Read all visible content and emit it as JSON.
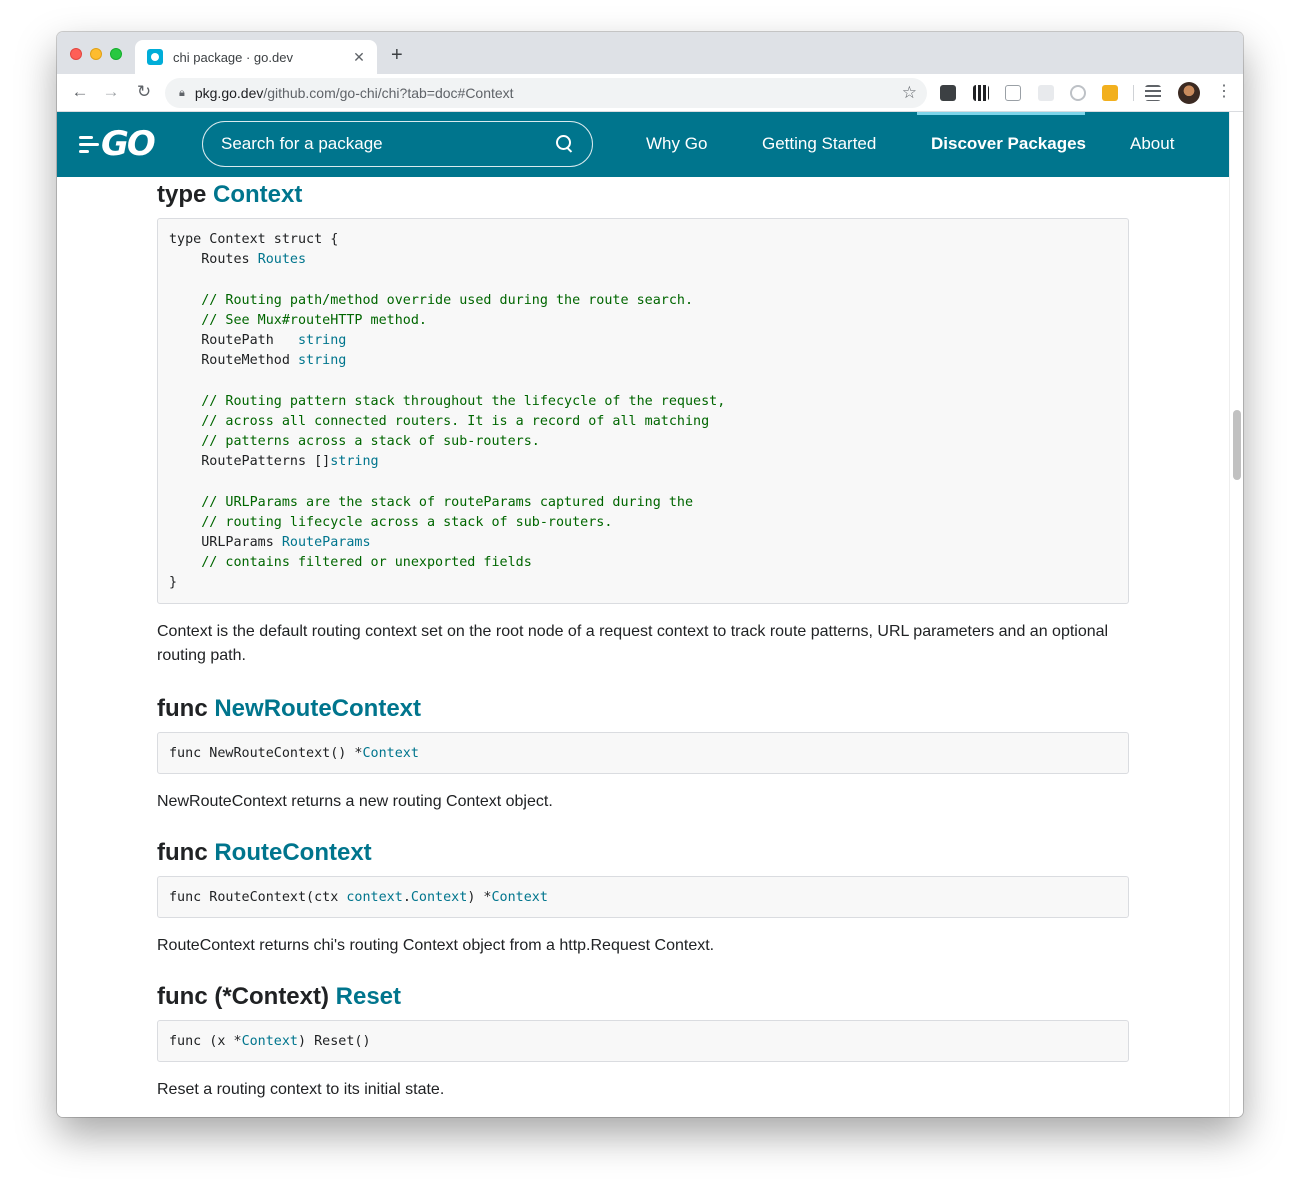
{
  "browser": {
    "tab_title": "chi package · go.dev",
    "tab_close": "✕",
    "new_tab": "+",
    "url_host": "pkg.go.dev",
    "url_path": "/github.com/go-chi/chi?tab=doc#Context"
  },
  "site": {
    "logo": "GO",
    "search_placeholder": "Search for a package",
    "nav": {
      "why_go": "Why Go",
      "getting_started": "Getting Started",
      "discover_packages": "Discover Packages",
      "about": "About"
    },
    "brand_color": "#00758d"
  },
  "doc": {
    "context": {
      "prefix": "type",
      "name": "Context",
      "code": {
        "l1": "type Context struct {",
        "routes_field": "    Routes ",
        "routes_type": "Routes",
        "comment1a": "    // Routing path/method override used during the route search.",
        "comment1b": "    // See Mux#routeHTTP method.",
        "routepath_field": "    RoutePath   ",
        "routepath_type": "string",
        "routemethod_field": "    RouteMethod ",
        "routemethod_type": "string",
        "comment2a": "    // Routing pattern stack throughout the lifecycle of the request,",
        "comment2b": "    // across all connected routers. It is a record of all matching",
        "comment2c": "    // patterns across a stack of sub-routers.",
        "routepatterns_field": "    RoutePatterns []",
        "routepatterns_type": "string",
        "comment3a": "    // URLParams are the stack of routeParams captured during the",
        "comment3b": "    // routing lifecycle across a stack of sub-routers.",
        "urlparams_field": "    URLParams ",
        "urlparams_type": "RouteParams",
        "comment4": "    // contains filtered or unexported fields",
        "close": "}"
      },
      "description": "Context is the default routing context set on the root node of a request context to track route patterns, URL parameters and an optional routing path."
    },
    "new_route_context": {
      "prefix": "func",
      "name": "NewRouteContext",
      "sig_a": "func NewRouteContext() *",
      "sig_type": "Context",
      "description": "NewRouteContext returns a new routing Context object."
    },
    "route_context": {
      "prefix": "func",
      "name": "RouteContext",
      "sig_a": "func RouteContext(ctx ",
      "sig_pkg": "context",
      "sig_dot": ".",
      "sig_ctx": "Context",
      "sig_b": ") *",
      "sig_type": "Context",
      "description": "RouteContext returns chi's routing Context object from a http.Request Context."
    },
    "reset": {
      "prefix": "func (*Context)",
      "name": "Reset",
      "sig_a": "func (x *",
      "sig_type": "Context",
      "sig_b": ") Reset()",
      "description": "Reset a routing context to its initial state."
    }
  }
}
